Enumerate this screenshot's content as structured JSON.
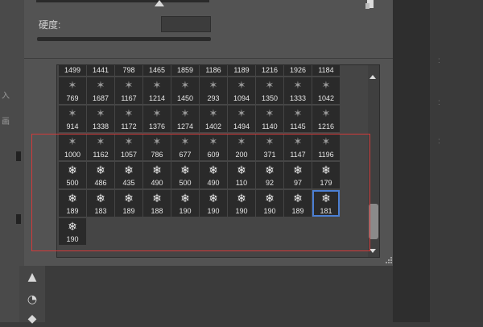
{
  "brush_panel": {
    "hardness_label": "硬度:",
    "hardness_value": ""
  },
  "brush_picker": {
    "selected": "181",
    "presets": [
      {
        "num": "1499",
        "icon": "brush"
      },
      {
        "num": "1441",
        "icon": "brush"
      },
      {
        "num": "798",
        "icon": "brush"
      },
      {
        "num": "1465",
        "icon": "brush"
      },
      {
        "num": "1859",
        "icon": "brush"
      },
      {
        "num": "1186",
        "icon": "brush"
      },
      {
        "num": "1189",
        "icon": "brush"
      },
      {
        "num": "1216",
        "icon": "brush"
      },
      {
        "num": "1926",
        "icon": "brush"
      },
      {
        "num": "1184",
        "icon": "brush"
      },
      {
        "num": "769",
        "icon": "brush"
      },
      {
        "num": "1687",
        "icon": "brush"
      },
      {
        "num": "1167",
        "icon": "brush"
      },
      {
        "num": "1214",
        "icon": "brush"
      },
      {
        "num": "1450",
        "icon": "brush"
      },
      {
        "num": "293",
        "icon": "brush"
      },
      {
        "num": "1094",
        "icon": "brush"
      },
      {
        "num": "1350",
        "icon": "brush"
      },
      {
        "num": "1333",
        "icon": "brush"
      },
      {
        "num": "1042",
        "icon": "brush"
      },
      {
        "num": "914",
        "icon": "brush"
      },
      {
        "num": "1338",
        "icon": "brush"
      },
      {
        "num": "1172",
        "icon": "brush"
      },
      {
        "num": "1376",
        "icon": "brush"
      },
      {
        "num": "1274",
        "icon": "brush"
      },
      {
        "num": "1402",
        "icon": "brush"
      },
      {
        "num": "1494",
        "icon": "brush"
      },
      {
        "num": "1140",
        "icon": "brush"
      },
      {
        "num": "1145",
        "icon": "brush"
      },
      {
        "num": "1216",
        "icon": "brush"
      },
      {
        "num": "1000",
        "icon": "brush"
      },
      {
        "num": "1162",
        "icon": "brush"
      },
      {
        "num": "1057",
        "icon": "brush"
      },
      {
        "num": "786",
        "icon": "brush"
      },
      {
        "num": "677",
        "icon": "brush"
      },
      {
        "num": "609",
        "icon": "brush"
      },
      {
        "num": "200",
        "icon": "brush"
      },
      {
        "num": "371",
        "icon": "brush"
      },
      {
        "num": "1147",
        "icon": "brush"
      },
      {
        "num": "1196",
        "icon": "brush"
      },
      {
        "num": "500",
        "icon": "snowflake"
      },
      {
        "num": "486",
        "icon": "snowflake"
      },
      {
        "num": "435",
        "icon": "snowflake"
      },
      {
        "num": "490",
        "icon": "snowflake"
      },
      {
        "num": "500",
        "icon": "snowflake"
      },
      {
        "num": "490",
        "icon": "snowflake"
      },
      {
        "num": "110",
        "icon": "snowflake"
      },
      {
        "num": "92",
        "icon": "snowflake"
      },
      {
        "num": "97",
        "icon": "snowflake"
      },
      {
        "num": "179",
        "icon": "snowflake"
      },
      {
        "num": "189",
        "icon": "snowflake"
      },
      {
        "num": "183",
        "icon": "snowflake"
      },
      {
        "num": "189",
        "icon": "snowflake"
      },
      {
        "num": "188",
        "icon": "snowflake"
      },
      {
        "num": "190",
        "icon": "snowflake"
      },
      {
        "num": "190",
        "icon": "snowflake"
      },
      {
        "num": "190",
        "icon": "snowflake"
      },
      {
        "num": "190",
        "icon": "snowflake"
      },
      {
        "num": "189",
        "icon": "snowflake"
      },
      {
        "num": "181",
        "icon": "snowflake"
      },
      {
        "num": "190",
        "icon": "snowflake"
      }
    ]
  },
  "colors": {
    "panel": "#535353",
    "cell": "#2a2a2a",
    "selection": "#4b7fd3",
    "annotation": "#d23a3a"
  }
}
